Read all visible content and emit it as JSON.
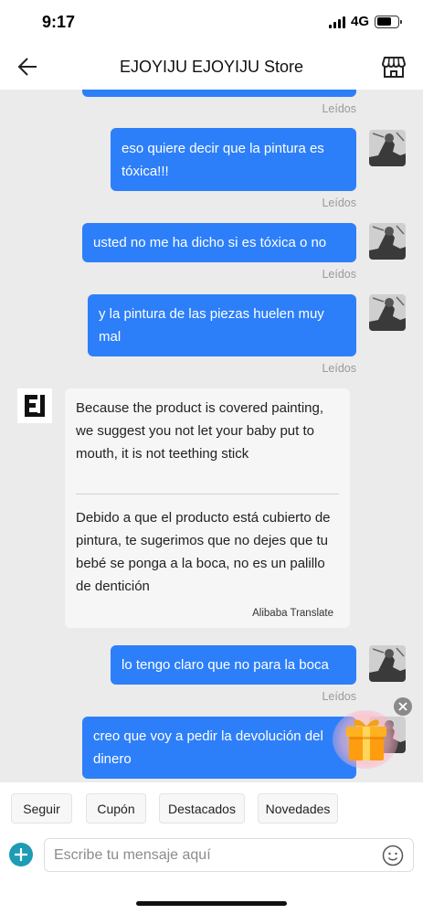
{
  "status_bar": {
    "time": "9:17",
    "network": "4G",
    "battery_level": 0.7
  },
  "header": {
    "title": "EJOYIJU EJOYIJU Store",
    "back_icon": "arrow-left-icon",
    "store_icon": "storefront-icon"
  },
  "chat": {
    "messages": [
      {
        "from": "me",
        "text": "",
        "status": "Leídos"
      },
      {
        "from": "me",
        "text": "eso quiere decir que la pintura es tóxica!!!",
        "status": "Leídos"
      },
      {
        "from": "me",
        "text": "usted no me ha dicho si es tóxica o no",
        "status": "Leídos"
      },
      {
        "from": "me",
        "text": "y la pintura de las piezas huelen muy mal",
        "status": "Leídos"
      },
      {
        "from": "store",
        "original": "Because the product is covered painting, we suggest you not let your baby put to mouth, it is not teething stick",
        "translated": "Debido a que el producto está cubierto de pintura, te sugerimos que no dejes que tu bebé se ponga a la boca, no es un palillo de dentición",
        "translate_credit": "Alibaba Translate"
      },
      {
        "from": "me",
        "text": "lo tengo claro que no para la boca",
        "status": "Leídos"
      },
      {
        "from": "me",
        "text": "creo que voy a pedir la devolución del dinero"
      }
    ]
  },
  "gift_widget": {
    "icon": "gift-box-icon",
    "close_icon": "close-icon"
  },
  "quick_replies": [
    "Seguir",
    "Cupón",
    "Destacados",
    "Novedades"
  ],
  "composer": {
    "placeholder": "Escribe tu mensaje aquí",
    "add_icon": "plus-icon",
    "emoji_icon": "smiley-icon"
  },
  "colors": {
    "outgoing_bubble": "#2d7ff9",
    "chat_background": "#ebebeb",
    "accent": "#1e9bb5"
  }
}
